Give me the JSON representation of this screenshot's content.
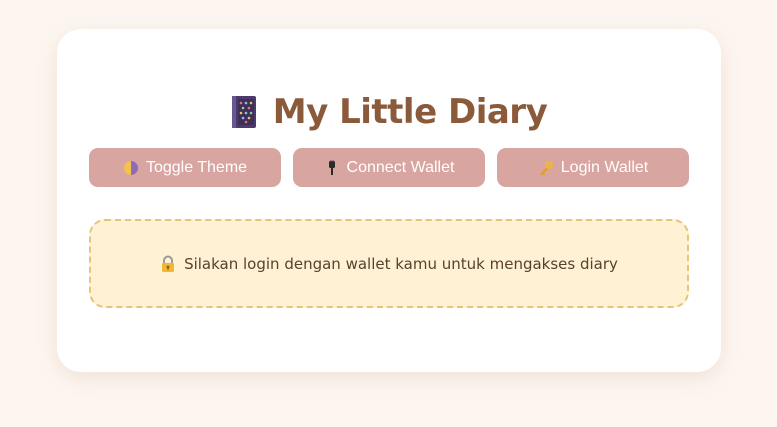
{
  "app": {
    "title": "My Little Diary",
    "title_icon": "book-icon"
  },
  "toolbar": {
    "toggle_theme_label": "Toggle Theme",
    "toggle_theme_icon": "half-moon-icon",
    "connect_wallet_label": "Connect Wallet",
    "connect_wallet_icon": "plug-icon",
    "login_wallet_label": "Login Wallet",
    "login_wallet_icon": "key-icon"
  },
  "notice": {
    "message": "Silakan login dengan wallet kamu untuk mengakses diary",
    "icon": "lock-with-key-icon"
  },
  "colors": {
    "page_background": "#fdf6f0",
    "card_background": "#ffffff",
    "title_text": "#8a5a3a",
    "button_background": "#d9a5a1",
    "button_text": "#ffffff",
    "notice_background": "#fff2d4",
    "notice_border": "#e6c57a"
  }
}
